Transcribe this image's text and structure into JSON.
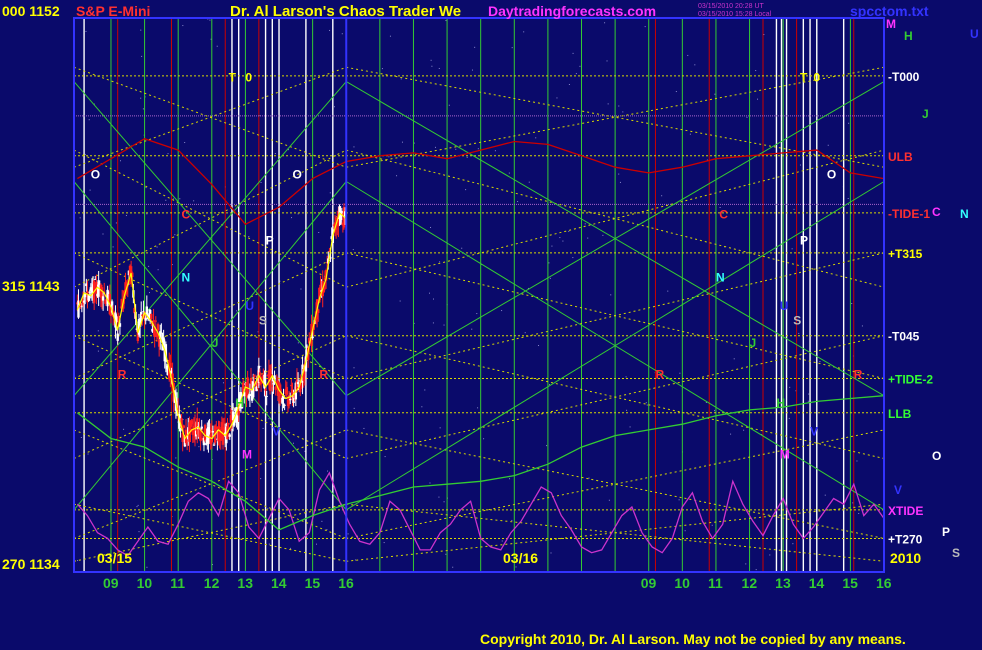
{
  "header": {
    "price_top_left": "000 1152",
    "symbol": "S&P E-Mini",
    "title": "Dr. Al Larson's Chaos Trader We",
    "site": "Daytradingforecasts.com",
    "stamp_line1": "03/15/2010 20:28 UT",
    "stamp_line2": "03/15/2010 15:28 Local",
    "file": "spcctom.txt"
  },
  "footer": {
    "copyright": "Copyright 2010, Dr. Al Larson. May not be copied by any means.",
    "year": "2010"
  },
  "colors": {
    "background": "#0a0a6b",
    "grid_yellow": "#d8d800",
    "grid_green": "#33cc33",
    "grid_red": "#cc0000",
    "grid_white": "#ffffff",
    "price_red": "#ff2020",
    "price_white": "#ffffff",
    "price_yellow": "#ffff00",
    "xtide_magenta": "#cc33cc",
    "axis_frame": "#3333ff"
  },
  "chart_data": {
    "type": "line",
    "title": "S&P E-Mini",
    "ylim": [
      1134,
      1152
    ],
    "y_tick_labels": [
      {
        "label": "000 1152",
        "value": 1152
      },
      {
        "label": "315 1143",
        "value": 1143
      },
      {
        "label": "270 1134",
        "value": 1134
      }
    ],
    "x_tick_labels": [
      "09",
      "10",
      "11",
      "12",
      "13",
      "14",
      "15",
      "16",
      "09",
      "10",
      "11",
      "12",
      "13",
      "14",
      "15",
      "16"
    ],
    "x_hours": [
      9,
      10,
      11,
      12,
      13,
      14,
      15,
      16,
      25,
      26,
      27,
      28,
      29,
      30,
      31,
      32
    ],
    "xlim": [
      7.9,
      32
    ],
    "date_labels": [
      {
        "label": "03/15",
        "x": 8.6
      },
      {
        "label": "03/16",
        "x": 24.6
      }
    ],
    "price_series": {
      "name": "S&P E-Mini",
      "x": [
        8.0,
        8.2,
        8.4,
        8.6,
        8.8,
        9.0,
        9.2,
        9.4,
        9.6,
        9.8,
        10.0,
        10.2,
        10.4,
        10.6,
        10.8,
        11.0,
        11.2,
        11.4,
        11.6,
        11.8,
        12.0,
        12.2,
        12.4,
        12.6,
        12.8,
        13.0,
        13.2,
        13.4,
        13.6,
        13.8,
        14.0,
        14.2,
        14.4,
        14.6,
        14.8,
        15.0,
        15.2,
        15.4,
        15.6,
        15.8,
        16.0
      ],
      "values": [
        1143.0,
        1143.6,
        1143.5,
        1143.8,
        1143.6,
        1143.1,
        1142.3,
        1143.5,
        1144.3,
        1142.2,
        1142.9,
        1142.6,
        1142.2,
        1141.6,
        1140.6,
        1139.3,
        1138.5,
        1138.8,
        1138.9,
        1138.6,
        1138.5,
        1138.8,
        1138.6,
        1139.0,
        1139.6,
        1140.3,
        1140.2,
        1140.7,
        1140.3,
        1140.7,
        1140.2,
        1139.9,
        1140.0,
        1140.3,
        1141.2,
        1142.3,
        1143.4,
        1144.1,
        1145.6,
        1146.4,
        1146.2
      ]
    },
    "series": [
      {
        "name": "XTIDE",
        "color": "#cc33cc",
        "x": [
          8.0,
          8.3,
          8.6,
          8.9,
          9.2,
          9.5,
          9.8,
          10.1,
          10.4,
          10.7,
          11.0,
          11.3,
          11.6,
          11.9,
          12.2,
          12.5,
          12.8,
          13.1,
          13.4,
          13.7,
          14.0,
          14.3,
          14.6,
          14.9,
          15.2,
          15.5,
          15.8,
          16.1,
          16.4,
          16.7,
          17.0,
          17.3,
          17.6,
          17.9,
          18.2,
          18.5,
          18.8,
          19.1,
          19.4,
          19.7,
          20.0,
          20.3,
          20.6,
          20.9,
          21.2,
          21.5,
          21.8,
          22.1,
          22.4,
          22.7,
          23.0,
          23.3,
          23.6,
          23.9,
          24.2,
          24.5,
          24.8,
          25.1,
          25.4,
          25.7,
          26.0,
          26.3,
          26.6,
          26.9,
          27.2,
          27.5,
          27.8,
          28.1,
          28.4,
          28.7,
          29.0,
          29.3,
          29.6,
          29.9,
          30.2,
          30.5,
          30.8,
          31.1,
          31.4,
          31.7,
          32.0
        ],
        "values": [
          1136.2,
          1135.8,
          1135.2,
          1135.0,
          1134.6,
          1134.4,
          1134.9,
          1135.4,
          1134.9,
          1134.8,
          1135.5,
          1136.3,
          1136.6,
          1136.4,
          1135.8,
          1137.0,
          1136.6,
          1135.4,
          1135.0,
          1135.7,
          1136.4,
          1136.0,
          1134.9,
          1135.2,
          1136.7,
          1137.3,
          1136.3,
          1135.5,
          1134.9,
          1134.8,
          1135.2,
          1136.3,
          1136.0,
          1135.3,
          1134.6,
          1134.6,
          1135.2,
          1135.5,
          1136.0,
          1136.3,
          1135.0,
          1134.7,
          1134.6,
          1135.2,
          1135.6,
          1136.2,
          1136.8,
          1136.6,
          1135.8,
          1135.3,
          1134.7,
          1134.5,
          1134.6,
          1135.2,
          1135.8,
          1136.1,
          1135.2,
          1134.7,
          1134.5,
          1135.0,
          1136.1,
          1136.6,
          1135.6,
          1135.0,
          1135.5,
          1137.0,
          1136.2,
          1135.6,
          1135.1,
          1135.8,
          1136.4,
          1135.5,
          1135.0,
          1135.4,
          1135.9,
          1136.4,
          1136.2,
          1136.9,
          1135.8,
          1136.2,
          1135.7
        ]
      },
      {
        "name": "ULB",
        "color": "#cc0000",
        "x": [
          8.0,
          9.0,
          10.0,
          11.0,
          12.0,
          13.0,
          14.0,
          15.0,
          16.0,
          17.0,
          18.0,
          19.0,
          20.0,
          21.0,
          22.0,
          23.0,
          24.0,
          25.0,
          26.0,
          27.0,
          28.0,
          29.0,
          30.0,
          31.0,
          32.0
        ],
        "values": [
          1147.6,
          1148.3,
          1149.0,
          1148.6,
          1147.4,
          1146.0,
          1146.6,
          1147.6,
          1148.2,
          1148.4,
          1148.5,
          1148.3,
          1148.6,
          1148.9,
          1148.8,
          1148.4,
          1148.0,
          1147.8,
          1148.0,
          1148.3,
          1148.4,
          1148.5,
          1148.6,
          1147.8,
          1147.6
        ]
      },
      {
        "name": "LLB",
        "color": "#33cc33",
        "x": [
          8.0,
          9.0,
          10.0,
          11.0,
          12.0,
          13.0,
          14.0,
          15.0,
          16.0,
          17.0,
          18.0,
          19.0,
          20.0,
          21.0,
          22.0,
          23.0,
          24.0,
          25.0,
          26.0,
          27.0,
          28.0,
          29.0,
          30.0,
          31.0,
          32.0
        ],
        "values": [
          1139.4,
          1138.5,
          1138.2,
          1137.5,
          1137.0,
          1136.3,
          1135.3,
          1135.8,
          1136.2,
          1136.5,
          1136.8,
          1136.9,
          1137.0,
          1137.2,
          1137.6,
          1138.2,
          1138.6,
          1138.8,
          1139.0,
          1139.3,
          1139.5,
          1139.6,
          1139.8,
          1139.9,
          1140.0
        ]
      }
    ],
    "horizontal_levels": [
      {
        "label": "-T000",
        "value": 1151.2
      },
      {
        "label": "ULB",
        "value": 1148.4
      },
      {
        "label": "-TIDE-1",
        "value": 1146.4
      },
      {
        "label": "+T315",
        "value": 1145.0
      },
      {
        "label": "-T045",
        "value": 1142.1
      },
      {
        "label": "+TIDE-2",
        "value": 1140.6
      },
      {
        "label": "LLB",
        "value": 1139.4
      },
      {
        "label": "XTIDE",
        "value": 1136.0
      },
      {
        "label": "+T270",
        "value": 1135.0
      }
    ],
    "side_letters": [
      {
        "label": "M",
        "color": "#ff33ff"
      },
      {
        "label": "U",
        "color": "#3333ff"
      },
      {
        "label": "H",
        "color": "#33cc33"
      },
      {
        "label": "J",
        "color": "#33cc33"
      },
      {
        "label": "C",
        "color": "#ff33ff"
      },
      {
        "label": "N",
        "color": "#33ffff"
      },
      {
        "label": "O",
        "color": "#ffffff"
      },
      {
        "label": "V",
        "color": "#3333ff"
      },
      {
        "label": "P",
        "color": "#ffffff"
      },
      {
        "label": "S",
        "color": "#bbbbbb"
      }
    ],
    "in_chart_letters": [
      {
        "label": "T",
        "x": 12.5,
        "y": 1151.0,
        "color": "#ffff00"
      },
      {
        "label": "0",
        "x": 13.0,
        "y": 1151.0,
        "color": "#ffff00"
      },
      {
        "label": "T",
        "x": 29.5,
        "y": 1151.0,
        "color": "#ffff00"
      },
      {
        "label": "0",
        "x": 29.9,
        "y": 1151.0,
        "color": "#ffff00"
      },
      {
        "label": "O",
        "x": 8.4,
        "y": 1147.6,
        "color": "#ffffff"
      },
      {
        "label": "O",
        "x": 14.4,
        "y": 1147.6,
        "color": "#ffffff"
      },
      {
        "label": "O",
        "x": 30.3,
        "y": 1147.6,
        "color": "#ffffff"
      },
      {
        "label": "C",
        "x": 11.1,
        "y": 1146.2,
        "color": "#ff3030"
      },
      {
        "label": "C",
        "x": 27.1,
        "y": 1146.2,
        "color": "#ff3030"
      },
      {
        "label": "P",
        "x": 13.6,
        "y": 1145.3,
        "color": "#ffffff"
      },
      {
        "label": "P",
        "x": 29.5,
        "y": 1145.3,
        "color": "#ffffff"
      },
      {
        "label": "N",
        "x": 11.1,
        "y": 1144.0,
        "color": "#33ffff"
      },
      {
        "label": "N",
        "x": 27.0,
        "y": 1144.0,
        "color": "#33ffff"
      },
      {
        "label": "U",
        "x": 13.0,
        "y": 1143.0,
        "color": "#3333ff"
      },
      {
        "label": "U",
        "x": 28.9,
        "y": 1143.0,
        "color": "#3333ff"
      },
      {
        "label": "S",
        "x": 13.4,
        "y": 1142.5,
        "color": "#bbbbbb"
      },
      {
        "label": "S",
        "x": 29.3,
        "y": 1142.5,
        "color": "#bbbbbb"
      },
      {
        "label": "J",
        "x": 12.0,
        "y": 1141.7,
        "color": "#33cc33"
      },
      {
        "label": "J",
        "x": 28.0,
        "y": 1141.7,
        "color": "#33cc33"
      },
      {
        "label": "R",
        "x": 9.2,
        "y": 1140.6,
        "color": "#ff3030"
      },
      {
        "label": "R",
        "x": 15.2,
        "y": 1140.6,
        "color": "#ff3030"
      },
      {
        "label": "R",
        "x": 25.2,
        "y": 1140.6,
        "color": "#ff3030"
      },
      {
        "label": "R",
        "x": 31.1,
        "y": 1140.6,
        "color": "#ff3030"
      },
      {
        "label": "H",
        "x": 12.7,
        "y": 1139.6,
        "color": "#33cc33"
      },
      {
        "label": "H",
        "x": 28.8,
        "y": 1139.6,
        "color": "#33cc33"
      },
      {
        "label": "V",
        "x": 13.8,
        "y": 1138.6,
        "color": "#3333ff"
      },
      {
        "label": "V",
        "x": 29.8,
        "y": 1138.6,
        "color": "#3333ff"
      },
      {
        "label": "M",
        "x": 12.9,
        "y": 1137.8,
        "color": "#ff33ff"
      },
      {
        "label": "M",
        "x": 28.9,
        "y": 1137.8,
        "color": "#ff33ff"
      }
    ],
    "vertical_lines": {
      "white": [
        8.2,
        12.6,
        12.8,
        13.6,
        13.8,
        14.0,
        14.8,
        15.6,
        16.0,
        28.8,
        28.95,
        29.1,
        29.6,
        29.8,
        30.0,
        30.8
      ],
      "green": [
        9.0,
        10.0,
        10.8,
        11.0,
        12.0,
        13.0,
        14.0,
        15.0,
        16.0,
        17.0,
        18.0,
        19.0,
        20.0,
        21.0,
        22.0,
        23.0,
        24.0,
        25.0,
        26.0,
        27.0,
        28.0,
        29.0,
        30.0,
        31.0,
        32.0
      ],
      "red": [
        9.2,
        10.8,
        12.4,
        13.4,
        25.2,
        26.8,
        28.4,
        29.4,
        31.1
      ]
    },
    "grid": true
  }
}
